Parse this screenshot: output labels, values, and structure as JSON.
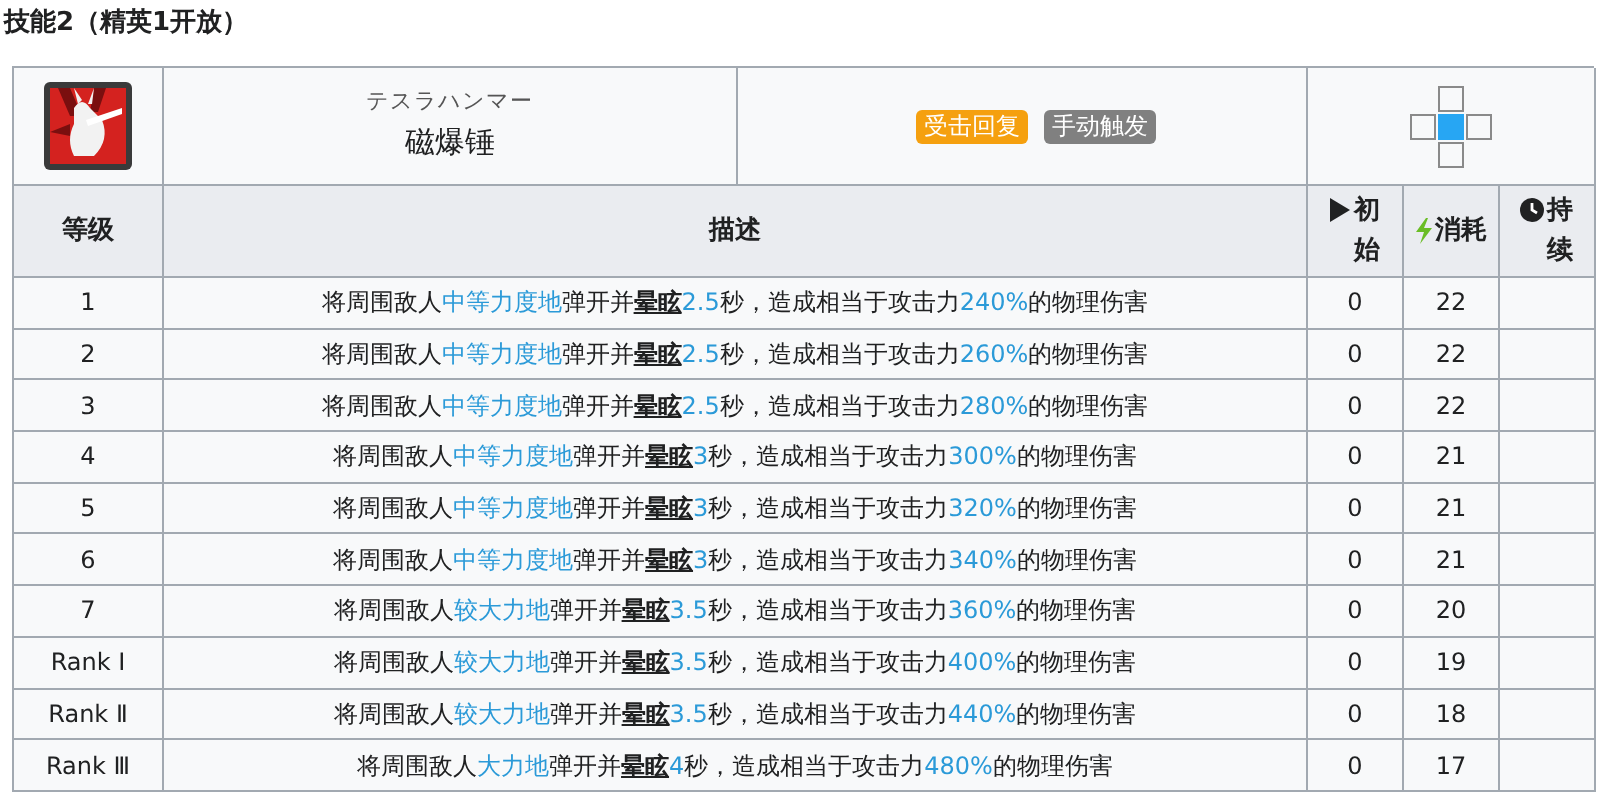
{
  "title": "技能2（精英1开放）",
  "skill": {
    "name_jp": "テスラハンマー",
    "name": "磁爆锤",
    "tags": [
      {
        "label": "受击回复",
        "color": "#f5a00f"
      },
      {
        "label": "手动触发",
        "color": "#808080"
      }
    ],
    "range": [
      {
        "kind": "none"
      },
      {
        "kind": "tile"
      },
      {
        "kind": "none"
      },
      {
        "kind": "tile"
      },
      {
        "kind": "self"
      },
      {
        "kind": "tile"
      },
      {
        "kind": "none"
      },
      {
        "kind": "tile"
      },
      {
        "kind": "none"
      }
    ]
  },
  "columns": [
    {
      "label": "等级"
    },
    {
      "label": "描述"
    },
    {
      "label": "初始"
    },
    {
      "label": "消耗"
    },
    {
      "label": "持续"
    }
  ],
  "rows": [
    {
      "level": "1",
      "description": [
        {
          "kind": "plain",
          "text": "将周围敌人"
        },
        {
          "kind": "value",
          "text": "中等力度地"
        },
        {
          "kind": "plain",
          "text": "弹开并"
        },
        {
          "kind": "term",
          "text": "晕眩"
        },
        {
          "kind": "value",
          "text": "2.5"
        },
        {
          "kind": "plain",
          "text": "秒，造成相当于攻击力"
        },
        {
          "kind": "value",
          "text": "240%"
        },
        {
          "kind": "plain",
          "text": "的物理伤害"
        }
      ],
      "initial": "0",
      "cost": "22"
    },
    {
      "level": "2",
      "description": [
        {
          "kind": "plain",
          "text": "将周围敌人"
        },
        {
          "kind": "value",
          "text": "中等力度地"
        },
        {
          "kind": "plain",
          "text": "弹开并"
        },
        {
          "kind": "term",
          "text": "晕眩"
        },
        {
          "kind": "value",
          "text": "2.5"
        },
        {
          "kind": "plain",
          "text": "秒，造成相当于攻击力"
        },
        {
          "kind": "value",
          "text": "260%"
        },
        {
          "kind": "plain",
          "text": "的物理伤害"
        }
      ],
      "initial": "0",
      "cost": "22"
    },
    {
      "level": "3",
      "description": [
        {
          "kind": "plain",
          "text": "将周围敌人"
        },
        {
          "kind": "value",
          "text": "中等力度地"
        },
        {
          "kind": "plain",
          "text": "弹开并"
        },
        {
          "kind": "term",
          "text": "晕眩"
        },
        {
          "kind": "value",
          "text": "2.5"
        },
        {
          "kind": "plain",
          "text": "秒，造成相当于攻击力"
        },
        {
          "kind": "value",
          "text": "280%"
        },
        {
          "kind": "plain",
          "text": "的物理伤害"
        }
      ],
      "initial": "0",
      "cost": "22"
    },
    {
      "level": "4",
      "description": [
        {
          "kind": "plain",
          "text": "将周围敌人"
        },
        {
          "kind": "value",
          "text": "中等力度地"
        },
        {
          "kind": "plain",
          "text": "弹开并"
        },
        {
          "kind": "term",
          "text": "晕眩"
        },
        {
          "kind": "value",
          "text": "3"
        },
        {
          "kind": "plain",
          "text": "秒，造成相当于攻击力"
        },
        {
          "kind": "value",
          "text": "300%"
        },
        {
          "kind": "plain",
          "text": "的物理伤害"
        }
      ],
      "initial": "0",
      "cost": "21"
    },
    {
      "level": "5",
      "description": [
        {
          "kind": "plain",
          "text": "将周围敌人"
        },
        {
          "kind": "value",
          "text": "中等力度地"
        },
        {
          "kind": "plain",
          "text": "弹开并"
        },
        {
          "kind": "term",
          "text": "晕眩"
        },
        {
          "kind": "value",
          "text": "3"
        },
        {
          "kind": "plain",
          "text": "秒，造成相当于攻击力"
        },
        {
          "kind": "value",
          "text": "320%"
        },
        {
          "kind": "plain",
          "text": "的物理伤害"
        }
      ],
      "initial": "0",
      "cost": "21"
    },
    {
      "level": "6",
      "description": [
        {
          "kind": "plain",
          "text": "将周围敌人"
        },
        {
          "kind": "value",
          "text": "中等力度地"
        },
        {
          "kind": "plain",
          "text": "弹开并"
        },
        {
          "kind": "term",
          "text": "晕眩"
        },
        {
          "kind": "value",
          "text": "3"
        },
        {
          "kind": "plain",
          "text": "秒，造成相当于攻击力"
        },
        {
          "kind": "value",
          "text": "340%"
        },
        {
          "kind": "plain",
          "text": "的物理伤害"
        }
      ],
      "initial": "0",
      "cost": "21"
    },
    {
      "level": "7",
      "description": [
        {
          "kind": "plain",
          "text": "将周围敌人"
        },
        {
          "kind": "value",
          "text": "较大力地"
        },
        {
          "kind": "plain",
          "text": "弹开并"
        },
        {
          "kind": "term",
          "text": "晕眩"
        },
        {
          "kind": "value",
          "text": "3.5"
        },
        {
          "kind": "plain",
          "text": "秒，造成相当于攻击力"
        },
        {
          "kind": "value",
          "text": "360%"
        },
        {
          "kind": "plain",
          "text": "的物理伤害"
        }
      ],
      "initial": "0",
      "cost": "20"
    },
    {
      "level": "Rank Ⅰ",
      "description": [
        {
          "kind": "plain",
          "text": "将周围敌人"
        },
        {
          "kind": "value",
          "text": "较大力地"
        },
        {
          "kind": "plain",
          "text": "弹开并"
        },
        {
          "kind": "term",
          "text": "晕眩"
        },
        {
          "kind": "value",
          "text": "3.5"
        },
        {
          "kind": "plain",
          "text": "秒，造成相当于攻击力"
        },
        {
          "kind": "value",
          "text": "400%"
        },
        {
          "kind": "plain",
          "text": "的物理伤害"
        }
      ],
      "initial": "0",
      "cost": "19"
    },
    {
      "level": "Rank Ⅱ",
      "description": [
        {
          "kind": "plain",
          "text": "将周围敌人"
        },
        {
          "kind": "value",
          "text": "较大力地"
        },
        {
          "kind": "plain",
          "text": "弹开并"
        },
        {
          "kind": "term",
          "text": "晕眩"
        },
        {
          "kind": "value",
          "text": "3.5"
        },
        {
          "kind": "plain",
          "text": "秒，造成相当于攻击力"
        },
        {
          "kind": "value",
          "text": "440%"
        },
        {
          "kind": "plain",
          "text": "的物理伤害"
        }
      ],
      "initial": "0",
      "cost": "18"
    },
    {
      "level": "Rank Ⅲ",
      "description": [
        {
          "kind": "plain",
          "text": "将周围敌人"
        },
        {
          "kind": "value",
          "text": "大力地"
        },
        {
          "kind": "plain",
          "text": "弹开并"
        },
        {
          "kind": "term",
          "text": "晕眩"
        },
        {
          "kind": "value",
          "text": "4"
        },
        {
          "kind": "plain",
          "text": "秒，造成相当于攻击力"
        },
        {
          "kind": "value",
          "text": "480%"
        },
        {
          "kind": "plain",
          "text": "的物理伤害"
        }
      ],
      "initial": "0",
      "cost": "17"
    }
  ]
}
